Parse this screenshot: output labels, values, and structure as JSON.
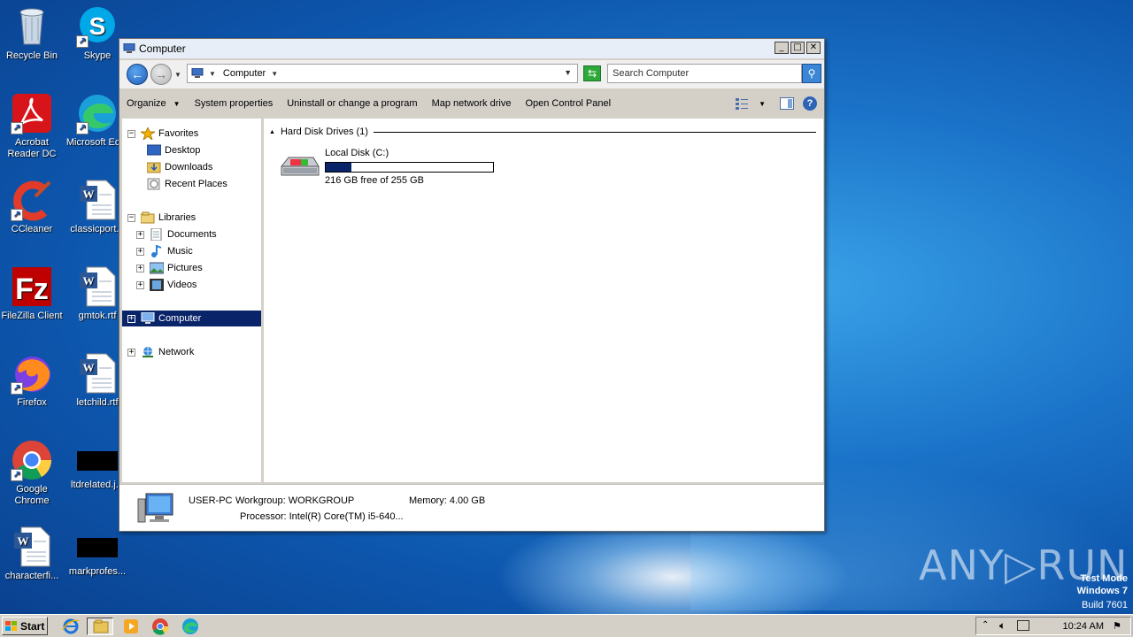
{
  "desktop": {
    "icons": [
      {
        "name": "recycle-bin",
        "label": "Recycle Bin"
      },
      {
        "name": "skype",
        "label": "Skype"
      },
      {
        "name": "acrobat-reader",
        "label": "Acrobat\nReader DC"
      },
      {
        "name": "microsoft-edge",
        "label": "Microsoft Ed..."
      },
      {
        "name": "ccleaner",
        "label": "CCleaner"
      },
      {
        "name": "classicport",
        "label": "classicport..."
      },
      {
        "name": "filezilla",
        "label": "FileZilla Client"
      },
      {
        "name": "gmtok",
        "label": "gmtok.rtf"
      },
      {
        "name": "firefox",
        "label": "Firefox"
      },
      {
        "name": "letchild",
        "label": "letchild.rtf"
      },
      {
        "name": "google-chrome",
        "label": "Google\nChrome"
      },
      {
        "name": "ltdrelated",
        "label": "ltdrelated.j..."
      },
      {
        "name": "characterfi",
        "label": "characterfi..."
      },
      {
        "name": "markprofes",
        "label": "markprofes..."
      }
    ],
    "watermark": {
      "line1": "Test Mode",
      "line2": "Windows 7",
      "line3": "Build 7601"
    },
    "brand": "ANY▷RUN"
  },
  "window": {
    "title": "Computer",
    "address_crumb": "Computer",
    "search_placeholder": "Search Computer",
    "commands": [
      "Organize",
      "System properties",
      "Uninstall or change a program",
      "Map network drive",
      "Open Control Panel"
    ],
    "nav": {
      "favorites": "Favorites",
      "desktop": "Desktop",
      "downloads": "Downloads",
      "recent": "Recent Places",
      "libraries": "Libraries",
      "documents": "Documents",
      "music": "Music",
      "pictures": "Pictures",
      "videos": "Videos",
      "computer": "Computer",
      "network": "Network"
    },
    "section_title": "Hard Disk Drives (1)",
    "drive": {
      "name": "Local Disk (C:)",
      "free_text": "216 GB free of 255 GB",
      "used_fraction": 0.153
    },
    "details": {
      "computer_name": "USER-PC",
      "workgroup": "Workgroup: WORKGROUP",
      "memory": "Memory: 4.00 GB",
      "processor": "Processor: Intel(R) Core(TM) i5-640..."
    }
  },
  "taskbar": {
    "start_label": "Start",
    "time": "10:24 AM"
  }
}
